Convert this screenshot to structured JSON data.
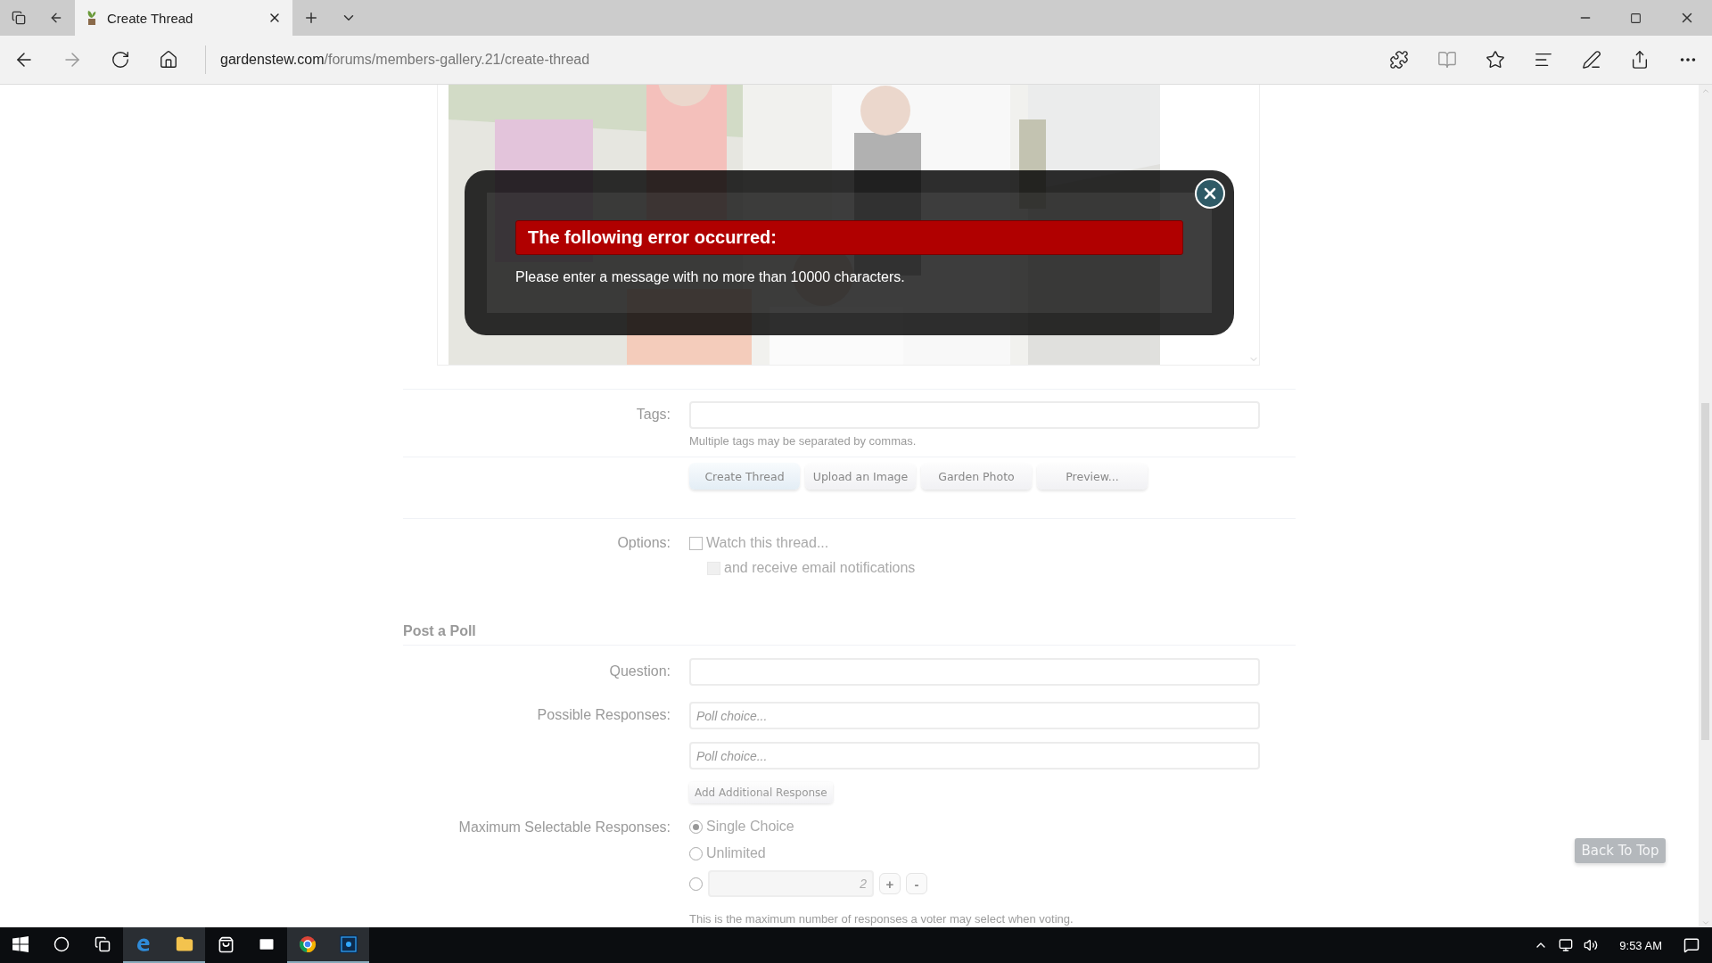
{
  "browser": {
    "tab_title": "Create Thread",
    "address": {
      "domain": "gardenstew.com",
      "path": "/forums/members-gallery.21/create-thread"
    }
  },
  "error_dialog": {
    "heading": "The following error occurred:",
    "message": "Please enter a message with no more than 10000 characters."
  },
  "form": {
    "tags": {
      "label": "Tags:",
      "hint": "Multiple tags may be separated by commas."
    },
    "buttons": [
      {
        "label": "Create Thread",
        "primary": true
      },
      {
        "label": "Upload an Image",
        "primary": false
      },
      {
        "label": "Garden Photo",
        "primary": false
      },
      {
        "label": "Preview...",
        "primary": false
      }
    ],
    "options": {
      "label": "Options:",
      "checkboxes": [
        {
          "label": "Watch this thread...",
          "checked": false,
          "disabled": false
        },
        {
          "label": "and receive email notifications",
          "checked": false,
          "disabled": true
        }
      ]
    }
  },
  "poll": {
    "heading": "Post a Poll",
    "question_label": "Question:",
    "responses_label": "Possible Responses:",
    "responses": [
      {
        "placeholder": "Poll choice..."
      },
      {
        "placeholder": "Poll choice..."
      }
    ],
    "add_button": "Add Additional Response",
    "max_label": "Maximum Selectable Responses:",
    "max_options": [
      {
        "kind": "text",
        "label": "Single Choice",
        "selected": true
      },
      {
        "kind": "text",
        "label": "Unlimited",
        "selected": false
      },
      {
        "kind": "number",
        "value": "2",
        "plus": "+",
        "minus": "-",
        "selected": false
      }
    ],
    "hint": "This is the maximum number of responses a voter may select when voting."
  },
  "back_to_top": "Back To Top",
  "taskbar": {
    "time": "9:53 AM"
  }
}
